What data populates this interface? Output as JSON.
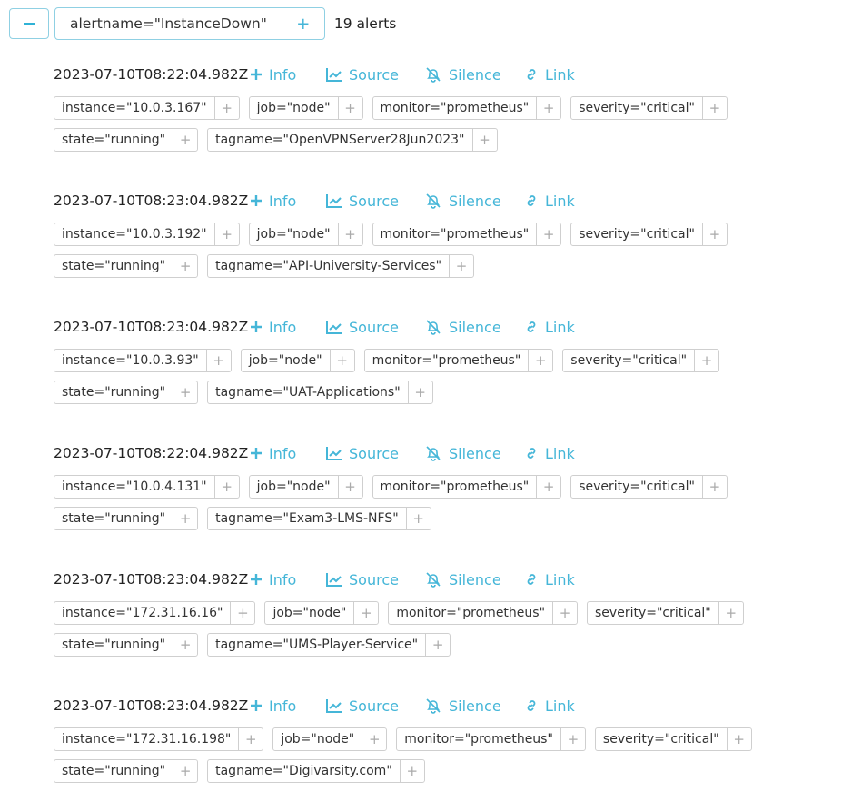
{
  "group": {
    "filter_label": "alertname=\"InstanceDown\"",
    "add_glyph": "+",
    "count_label": "19 alerts"
  },
  "actions": {
    "info": "Info",
    "source": "Source",
    "silence": "Silence",
    "link": "Link"
  },
  "chip_plus": "+",
  "colors": {
    "accent": "#45b6d8",
    "border": "#8fd0e3"
  },
  "alerts": [
    {
      "timestamp": "2023-07-10T08:22:04.982Z",
      "labels": [
        "instance=\"10.0.3.167\"",
        "job=\"node\"",
        "monitor=\"prometheus\"",
        "severity=\"critical\"",
        "state=\"running\"",
        "tagname=\"OpenVPNServer28Jun2023\""
      ]
    },
    {
      "timestamp": "2023-07-10T08:23:04.982Z",
      "labels": [
        "instance=\"10.0.3.192\"",
        "job=\"node\"",
        "monitor=\"prometheus\"",
        "severity=\"critical\"",
        "state=\"running\"",
        "tagname=\"API-University-Services\""
      ]
    },
    {
      "timestamp": "2023-07-10T08:23:04.982Z",
      "labels": [
        "instance=\"10.0.3.93\"",
        "job=\"node\"",
        "monitor=\"prometheus\"",
        "severity=\"critical\"",
        "state=\"running\"",
        "tagname=\"UAT-Applications\""
      ]
    },
    {
      "timestamp": "2023-07-10T08:22:04.982Z",
      "labels": [
        "instance=\"10.0.4.131\"",
        "job=\"node\"",
        "monitor=\"prometheus\"",
        "severity=\"critical\"",
        "state=\"running\"",
        "tagname=\"Exam3-LMS-NFS\""
      ]
    },
    {
      "timestamp": "2023-07-10T08:23:04.982Z",
      "labels": [
        "instance=\"172.31.16.16\"",
        "job=\"node\"",
        "monitor=\"prometheus\"",
        "severity=\"critical\"",
        "state=\"running\"",
        "tagname=\"UMS-Player-Service\""
      ]
    },
    {
      "timestamp": "2023-07-10T08:23:04.982Z",
      "labels": [
        "instance=\"172.31.16.198\"",
        "job=\"node\"",
        "monitor=\"prometheus\"",
        "severity=\"critical\"",
        "state=\"running\"",
        "tagname=\"Digivarsity.com\""
      ]
    }
  ]
}
